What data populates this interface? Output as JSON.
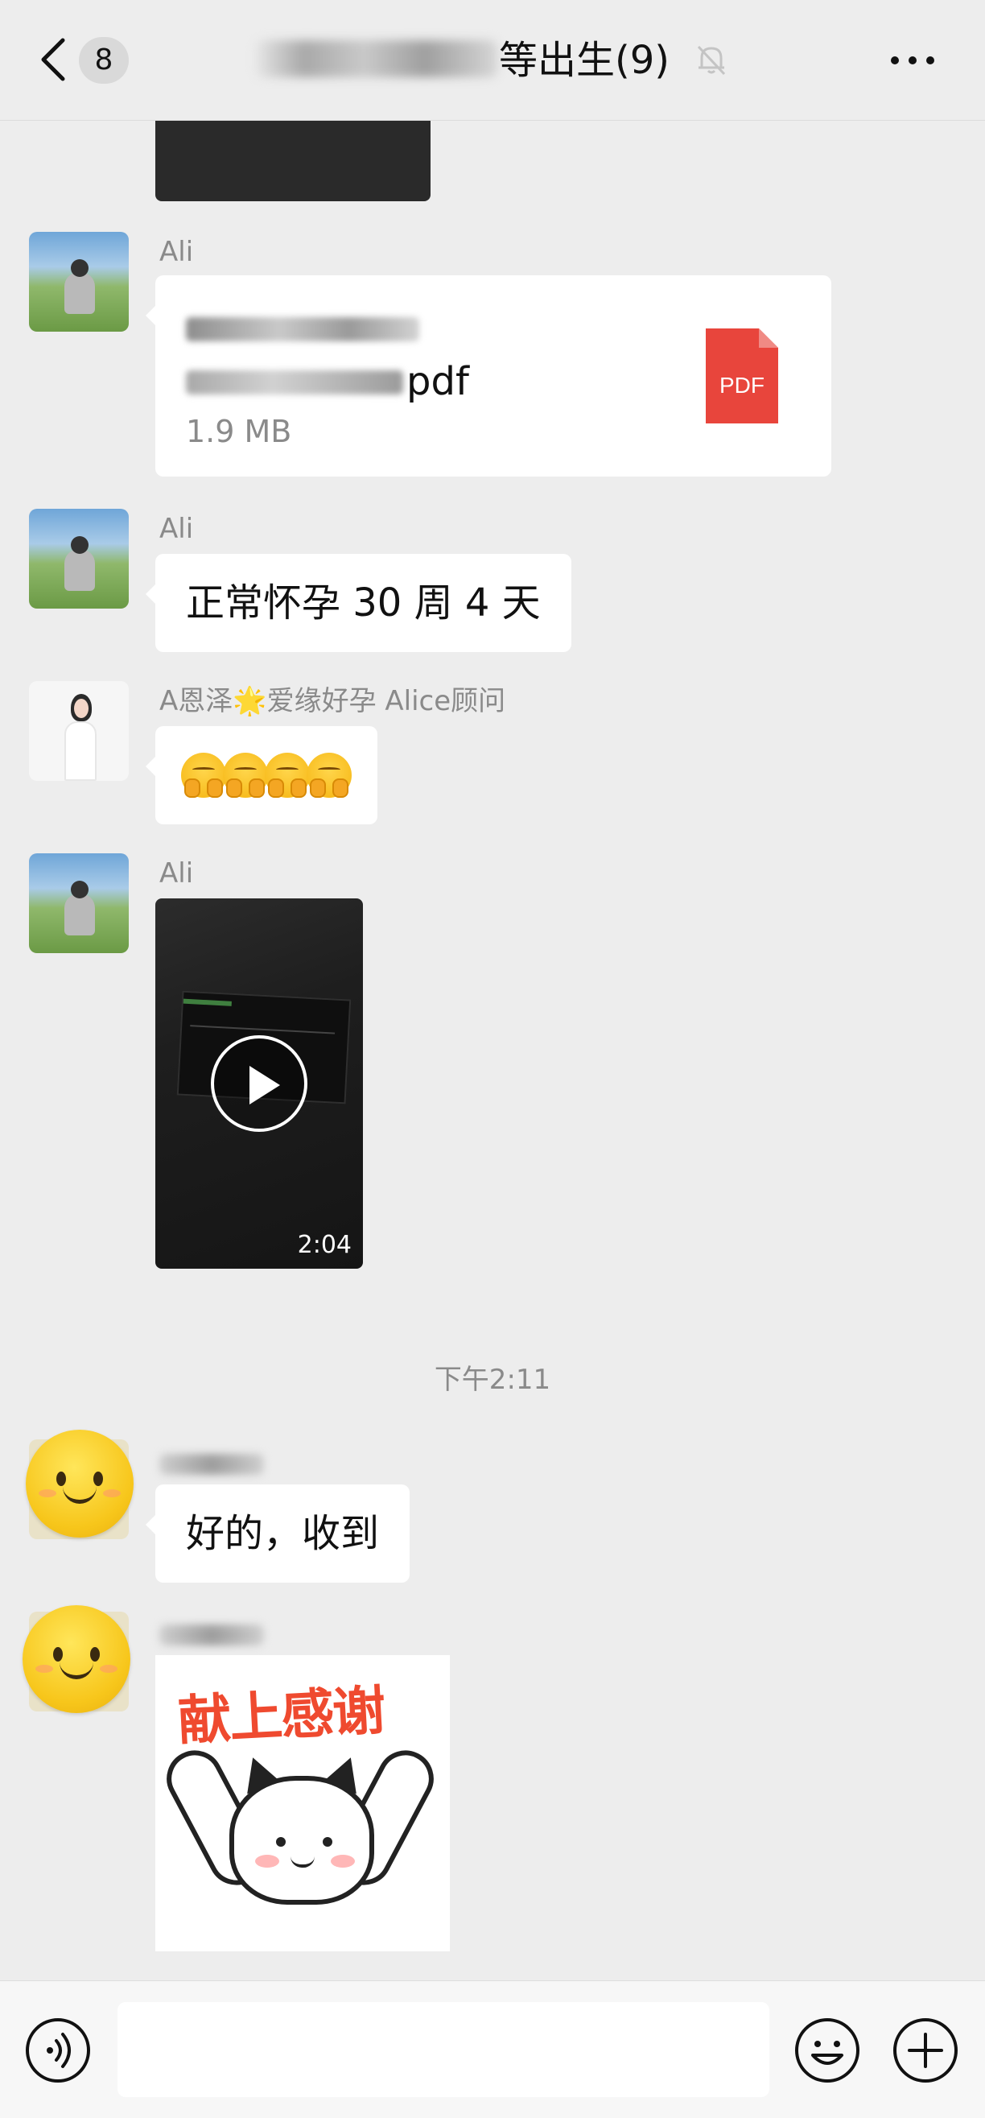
{
  "header": {
    "unread_count": "8",
    "title": "等出生(9)",
    "icons": {
      "back": "chevron-left-icon",
      "mute": "bell-off-icon",
      "more": "more-horizontal-icon"
    }
  },
  "messages": [
    {
      "type": "image_partial"
    },
    {
      "sender": "Ali",
      "type": "file",
      "file_ext": "pdf",
      "file_size": "1.9 MB",
      "file_icon_label": "PDF"
    },
    {
      "sender": "Ali",
      "type": "text",
      "text": "正常怀孕 30 周 4 天"
    },
    {
      "sender": "A恩泽🌟爱缘好孕 Alice顾问",
      "type": "emoji",
      "emoji": "🤭🤭🤭🤭"
    },
    {
      "sender": "Ali",
      "type": "video",
      "duration": "2:04"
    },
    {
      "type": "timestamp",
      "text": "下午2:11"
    },
    {
      "sender": "",
      "type": "text",
      "text": "好的，收到"
    },
    {
      "sender": "",
      "type": "sticker",
      "sticker_text": "献上感谢"
    }
  ],
  "colors": {
    "background": "#ededed",
    "bubble": "#ffffff",
    "pdf_red": "#e8453c",
    "sticker_red": "#ef4a2f"
  }
}
